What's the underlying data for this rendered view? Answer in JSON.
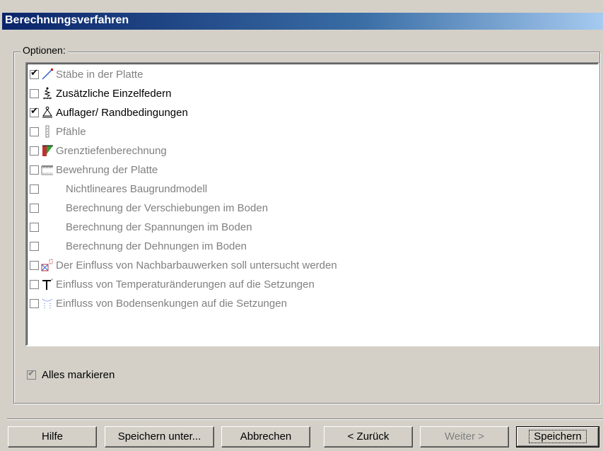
{
  "window": {
    "title": "Berechnungsverfahren"
  },
  "options_group": {
    "label": "Optionen:"
  },
  "options": [
    {
      "label": "Stäbe in der Platte",
      "checked": true,
      "enabled": false,
      "icon": "beam-icon"
    },
    {
      "label": "Zusätzliche Einzelfedern",
      "checked": false,
      "enabled": true,
      "icon": "spring-icon"
    },
    {
      "label": "Auflager/ Randbedingungen",
      "checked": true,
      "enabled": true,
      "icon": "support-icon"
    },
    {
      "label": "Pfähle",
      "checked": false,
      "enabled": false,
      "icon": "pile-icon"
    },
    {
      "label": "Grenztiefenberechnung",
      "checked": false,
      "enabled": false,
      "icon": "depth-limit-icon"
    },
    {
      "label": "Bewehrung der Platte",
      "checked": false,
      "enabled": false,
      "icon": "reinforcement-icon"
    },
    {
      "label": "Nichtlineares Baugrundmodell",
      "checked": false,
      "enabled": false,
      "icon": ""
    },
    {
      "label": "Berechnung der Verschiebungen im Boden",
      "checked": false,
      "enabled": false,
      "icon": ""
    },
    {
      "label": "Berechnung der Spannungen im Boden",
      "checked": false,
      "enabled": false,
      "icon": ""
    },
    {
      "label": "Berechnung der Dehnungen im Boden",
      "checked": false,
      "enabled": false,
      "icon": ""
    },
    {
      "label": "Der Einfluss von Nachbarbauwerken soll untersucht werden",
      "checked": false,
      "enabled": false,
      "icon": "neighbor-building-icon"
    },
    {
      "label": "Einfluss von Temperaturänderungen auf die Setzungen",
      "checked": false,
      "enabled": false,
      "icon": "temperature-icon"
    },
    {
      "label": "Einfluss von Bodensenkungen auf die Setzungen",
      "checked": false,
      "enabled": false,
      "icon": "subsidence-icon"
    }
  ],
  "select_all": {
    "label": "Alles markieren",
    "checked": true,
    "enabled": false
  },
  "buttons": {
    "help": "Hilfe",
    "save_as": "Speichern unter...",
    "cancel": "Abbrechen",
    "back": "< Zurück",
    "next": "Weiter >",
    "save": "Speichern"
  },
  "colors": {
    "titlebar": "#0a246a",
    "face": "#d4d0c8",
    "disabled_text": "#808080"
  }
}
